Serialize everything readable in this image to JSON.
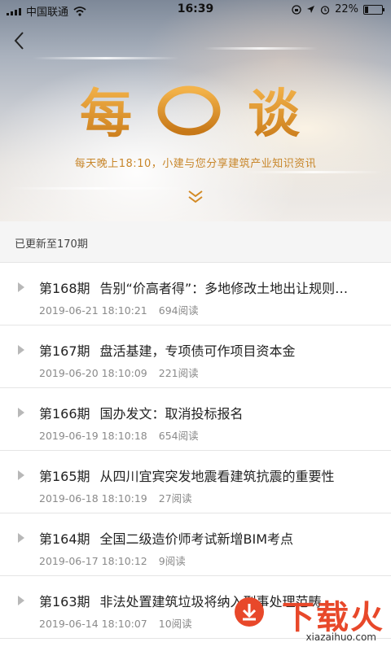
{
  "status_bar": {
    "carrier": "中国联通",
    "time": "16:39",
    "battery": "22%",
    "battery_level": 0.22
  },
  "header": {
    "logo_text": "每日一谈",
    "subtitle": "每天晚上18:10，小建与您分享建筑产业知识资讯"
  },
  "update_info": "已更新至170期",
  "episodes": [
    {
      "ep": "第168期",
      "title": "告别“价高者得”：多地修改土地出让规则…",
      "date": "2019-06-21 18:10:21",
      "views": "694阅读"
    },
    {
      "ep": "第167期",
      "title": "盘活基建，专项债可作项目资本金",
      "date": "2019-06-20 18:10:09",
      "views": "221阅读"
    },
    {
      "ep": "第166期",
      "title": "国办发文：取消投标报名",
      "date": "2019-06-19 18:10:18",
      "views": "654阅读"
    },
    {
      "ep": "第165期",
      "title": "从四川宜宾突发地震看建筑抗震的重要性",
      "date": "2019-06-18 18:10:19",
      "views": "27阅读"
    },
    {
      "ep": "第164期",
      "title": "全国二级造价师考试新增BIM考点",
      "date": "2019-06-17 18:10:12",
      "views": "9阅读"
    },
    {
      "ep": "第163期",
      "title": "非法处置建筑垃圾将纳入刑事处理范畴",
      "date": "2019-06-14 18:10:07",
      "views": "10阅读"
    }
  ],
  "watermark": {
    "brand": "下载火",
    "url": "xiazaihuo.com"
  },
  "colors": {
    "accent": "#d38a24",
    "watermark": "#e8482a"
  }
}
